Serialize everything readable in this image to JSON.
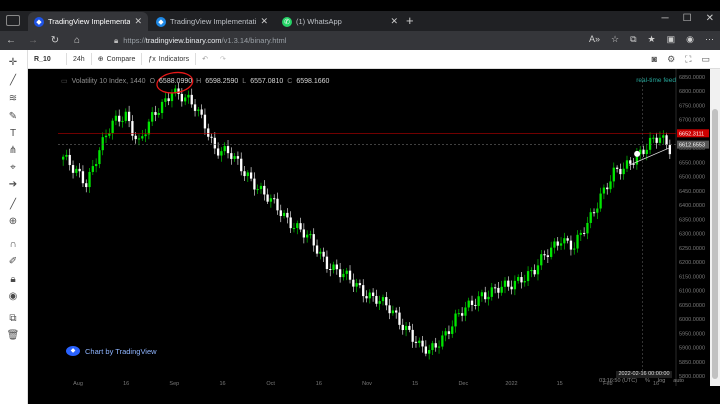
{
  "browser": {
    "tabs": [
      {
        "title": "TradingView Implementation for",
        "active": true,
        "favicon": "tradingview-favicon"
      },
      {
        "title": "TradingView Implementation for",
        "active": false,
        "favicon": "tradingview-favicon"
      },
      {
        "title": "(1) WhatsApp",
        "active": false,
        "favicon": "whatsapp-favicon"
      }
    ],
    "url_prefix": "https://",
    "url_host": "tradingview.binary.com",
    "url_path": "/v1.3.14/binary.html"
  },
  "toolbar": {
    "symbol": "R_10",
    "interval": "24h",
    "compare_label": "Compare",
    "indicators_label": "Indicators"
  },
  "legend": {
    "title": "Volatility 10 Index, 1440",
    "o_label": "O",
    "o": "6588.0990",
    "h_label": "H",
    "h": "6598.2590",
    "l_label": "L",
    "l": "6557.0810",
    "c_label": "C",
    "c": "6598.1660"
  },
  "status_text": "real-time feed",
  "watermark_text": "Chart by TradingView",
  "timestamp_text": "2022-02-16 00:00:00",
  "bottom": {
    "time": "03:16:50 (UTC)",
    "pct": "%",
    "log": "log",
    "auto": "auto"
  },
  "colors": {
    "up": "#00e600",
    "down": "#ffffff",
    "background": "#000000",
    "price_line": "#cc0000",
    "annotation": "#e81818",
    "accent": "#2962ff"
  },
  "chart_data": {
    "type": "candlestick",
    "symbol": "Volatility 10 Index",
    "interval": "1440",
    "y_axis": {
      "range": [
        5800,
        6850
      ],
      "tick_labels": [
        "6850.0000",
        "6800.0000",
        "6750.0000",
        "6700.0000",
        "6650.0000",
        "6600.0000",
        "6550.0000",
        "6500.0000",
        "6450.0000",
        "6400.0000",
        "6350.0000",
        "6300.0000",
        "6250.0000",
        "6200.0000",
        "6150.0000",
        "6100.0000",
        "6050.0000",
        "6000.0000",
        "5950.0000",
        "5900.0000",
        "5850.0000",
        "5800.0000"
      ]
    },
    "x_axis": {
      "tick_labels": [
        "Aug",
        "16",
        "Sep",
        "16",
        "Oct",
        "16",
        "Nov",
        "15",
        "Dec",
        "2022",
        "15",
        "Feb",
        "16"
      ]
    },
    "price_labels": [
      {
        "label": "6652.3111",
        "price": 6652.3111,
        "color": "#cc0000"
      },
      {
        "label": "6612.6553",
        "price": 6612.6553,
        "color": "#555555"
      }
    ],
    "close_path": [
      {
        "i": 0,
        "c": 6570
      },
      {
        "i": 3,
        "c": 6520
      },
      {
        "i": 7,
        "c": 6480
      },
      {
        "i": 11,
        "c": 6600
      },
      {
        "i": 15,
        "c": 6680
      },
      {
        "i": 19,
        "c": 6720
      },
      {
        "i": 23,
        "c": 6620
      },
      {
        "i": 27,
        "c": 6700
      },
      {
        "i": 31,
        "c": 6770
      },
      {
        "i": 33,
        "c": 6810
      },
      {
        "i": 36,
        "c": 6780
      },
      {
        "i": 40,
        "c": 6740
      },
      {
        "i": 43,
        "c": 6690
      },
      {
        "i": 46,
        "c": 6600
      },
      {
        "i": 51,
        "c": 6570
      },
      {
        "i": 56,
        "c": 6510
      },
      {
        "i": 61,
        "c": 6430
      },
      {
        "i": 66,
        "c": 6380
      },
      {
        "i": 71,
        "c": 6320
      },
      {
        "i": 76,
        "c": 6260
      },
      {
        "i": 80,
        "c": 6200
      },
      {
        "i": 85,
        "c": 6150
      },
      {
        "i": 90,
        "c": 6110
      },
      {
        "i": 95,
        "c": 6070
      },
      {
        "i": 100,
        "c": 6020
      },
      {
        "i": 105,
        "c": 5960
      },
      {
        "i": 108,
        "c": 5900
      },
      {
        "i": 111,
        "c": 5880
      },
      {
        "i": 115,
        "c": 5940
      },
      {
        "i": 119,
        "c": 6000
      },
      {
        "i": 123,
        "c": 6040
      },
      {
        "i": 127,
        "c": 6090
      },
      {
        "i": 131,
        "c": 6100
      },
      {
        "i": 135,
        "c": 6110
      },
      {
        "i": 139,
        "c": 6150
      },
      {
        "i": 143,
        "c": 6170
      },
      {
        "i": 147,
        "c": 6230
      },
      {
        "i": 151,
        "c": 6290
      },
      {
        "i": 155,
        "c": 6250
      },
      {
        "i": 159,
        "c": 6330
      },
      {
        "i": 163,
        "c": 6440
      },
      {
        "i": 167,
        "c": 6510
      },
      {
        "i": 170,
        "c": 6520
      },
      {
        "i": 174,
        "c": 6580
      },
      {
        "i": 178,
        "c": 6620
      },
      {
        "i": 181,
        "c": 6630
      },
      {
        "i": 184,
        "c": 6598
      }
    ],
    "candle_count": 185,
    "annotations": [
      "hand-drawn red circle around top",
      "trend line near last candles"
    ]
  }
}
